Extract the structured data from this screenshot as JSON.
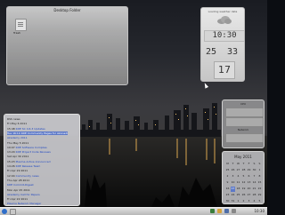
{
  "folder_view": {
    "title": "Desktop Folder",
    "icon_label": "Trash"
  },
  "weather": {
    "title": "Loading weather data",
    "icon": "cloud-icon",
    "time": "10:30",
    "temp_high": "25",
    "temp_low": "33",
    "day": "17"
  },
  "feed": {
    "items": [
      {
        "meta": "RSS news",
        "link": ""
      },
      {
        "meta": "Fri May 6 2011",
        "link": ""
      },
      {
        "meta": "15:48",
        "link": "KDE SC 4.6.3 Updates"
      },
      {
        "meta": "Tue 16:10",
        "link": "KDE Community Pages for Akonadi"
      },
      {
        "meta": "",
        "link": "Akademy 2011"
      },
      {
        "meta": "Thu May 5 2011",
        "link": ""
      },
      {
        "meta": "19:07",
        "link": "KDE Software Compiles"
      },
      {
        "meta": "13:20",
        "link": "KDE Project Code Reviews"
      },
      {
        "meta": "Sat Apr 30 2011",
        "link": ""
      },
      {
        "meta": "15:23",
        "link": "Plasma Active Announced"
      },
      {
        "meta": "14:26",
        "link": "KDE Release Team"
      },
      {
        "meta": "Fri Apr 29 2011",
        "link": ""
      },
      {
        "meta": "12:04",
        "link": "Community news"
      },
      {
        "meta": "Thu Apr 28 2011",
        "link": ""
      },
      {
        "meta": "",
        "link": "KDE Commit-Digest"
      },
      {
        "meta": "Mon Apr 25 2011",
        "link": ""
      },
      {
        "meta": "",
        "link": "Akademy Call for Papers"
      },
      {
        "meta": "Fri Apr 22 2011",
        "link": ""
      },
      {
        "meta": "",
        "link": "Plasma Network Manager"
      }
    ]
  },
  "sysmon": {
    "title": "CPU",
    "label2": "Network"
  },
  "calendar": {
    "month": "May 2011",
    "headers": [
      "M",
      "T",
      "W",
      "T",
      "F",
      "S",
      "S"
    ],
    "days": [
      "25",
      "26",
      "27",
      "28",
      "29",
      "30",
      "1",
      "2",
      "3",
      "4",
      "5",
      "6",
      "7",
      "8",
      "9",
      "10",
      "11",
      "12",
      "13",
      "14",
      "15",
      "16",
      "17",
      "18",
      "19",
      "20",
      "21",
      "22",
      "23",
      "24",
      "25",
      "26",
      "27",
      "28",
      "29",
      "30",
      "31",
      "1",
      "2",
      "3",
      "4",
      "5"
    ],
    "today": "17"
  },
  "taskbar": {
    "clock": "10:30"
  },
  "colors": {
    "highlight": "#5d79c8",
    "link": "#1f47c2",
    "kde_blue": "#2f6ec9"
  }
}
